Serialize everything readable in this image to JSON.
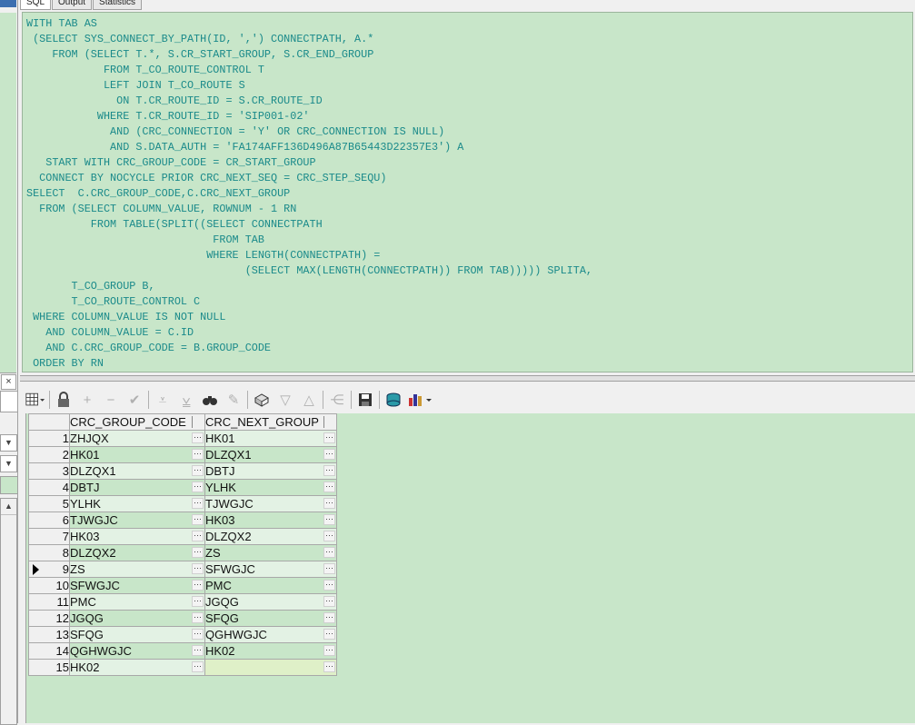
{
  "tabs": [
    {
      "label": "SQL",
      "active": true
    },
    {
      "label": "Output",
      "active": false
    },
    {
      "label": "Statistics",
      "active": false
    }
  ],
  "sql_lines": [
    "WITH TAB AS",
    " (SELECT SYS_CONNECT_BY_PATH(ID, ',') CONNECTPATH, A.*",
    "    FROM (SELECT T.*, S.CR_START_GROUP, S.CR_END_GROUP",
    "            FROM T_CO_ROUTE_CONTROL T",
    "            LEFT JOIN T_CO_ROUTE S",
    "              ON T.CR_ROUTE_ID = S.CR_ROUTE_ID",
    "           WHERE T.CR_ROUTE_ID = 'SIP001-02'",
    "             AND (CRC_CONNECTION = 'Y' OR CRC_CONNECTION IS NULL)",
    "             AND S.DATA_AUTH = 'FA174AFF136D496A87B65443D22357E3') A",
    "   START WITH CRC_GROUP_CODE = CR_START_GROUP",
    "  CONNECT BY NOCYCLE PRIOR CRC_NEXT_SEQ = CRC_STEP_SEQU)",
    "SELECT  C.CRC_GROUP_CODE,C.CRC_NEXT_GROUP",
    "  FROM (SELECT COLUMN_VALUE, ROWNUM - 1 RN",
    "          FROM TABLE(SPLIT((SELECT CONNECTPATH",
    "                             FROM TAB",
    "                            WHERE LENGTH(CONNECTPATH) =",
    "                                  (SELECT MAX(LENGTH(CONNECTPATH)) FROM TAB))))) SPLITA,",
    "       T_CO_GROUP B,",
    "       T_CO_ROUTE_CONTROL C",
    " WHERE COLUMN_VALUE IS NOT NULL",
    "   AND COLUMN_VALUE = C.ID",
    "   AND C.CRC_GROUP_CODE = B.GROUP_CODE",
    " ORDER BY RN"
  ],
  "toolbar": {
    "buttons": [
      "grid-menu-icon",
      "lock-icon",
      "add-record-icon",
      "delete-record-icon",
      "post-changes-icon",
      "fetch-next-icon",
      "fetch-last-icon",
      "find-icon",
      "clear-icon",
      "query-by-example-icon",
      "sort-down-icon",
      "sort-up-icon",
      "link-icon",
      "save-icon",
      "export-icon",
      "chart-icon"
    ]
  },
  "grid": {
    "columns": [
      "CRC_GROUP_CODE",
      "CRC_NEXT_GROUP"
    ],
    "current_row": 9,
    "rows": [
      {
        "num": "1",
        "c1": "ZHJQX",
        "c2": "HK01"
      },
      {
        "num": "2",
        "c1": "HK01",
        "c2": "DLZQX1"
      },
      {
        "num": "3",
        "c1": "DLZQX1",
        "c2": "DBTJ"
      },
      {
        "num": "4",
        "c1": "DBTJ",
        "c2": "YLHK"
      },
      {
        "num": "5",
        "c1": "YLHK",
        "c2": "TJWGJC"
      },
      {
        "num": "6",
        "c1": "TJWGJC",
        "c2": "HK03"
      },
      {
        "num": "7",
        "c1": "HK03",
        "c2": "DLZQX2"
      },
      {
        "num": "8",
        "c1": "DLZQX2",
        "c2": "ZS"
      },
      {
        "num": "9",
        "c1": "ZS",
        "c2": "SFWGJC"
      },
      {
        "num": "10",
        "c1": "SFWGJC",
        "c2": "PMC"
      },
      {
        "num": "11",
        "c1": "PMC",
        "c2": "JGQG"
      },
      {
        "num": "12",
        "c1": "JGQG",
        "c2": "SFQG"
      },
      {
        "num": "13",
        "c1": "SFQG",
        "c2": "QGHWGJC"
      },
      {
        "num": "14",
        "c1": "QGHWGJC",
        "c2": "HK02"
      },
      {
        "num": "15",
        "c1": "HK02",
        "c2": ""
      }
    ]
  }
}
